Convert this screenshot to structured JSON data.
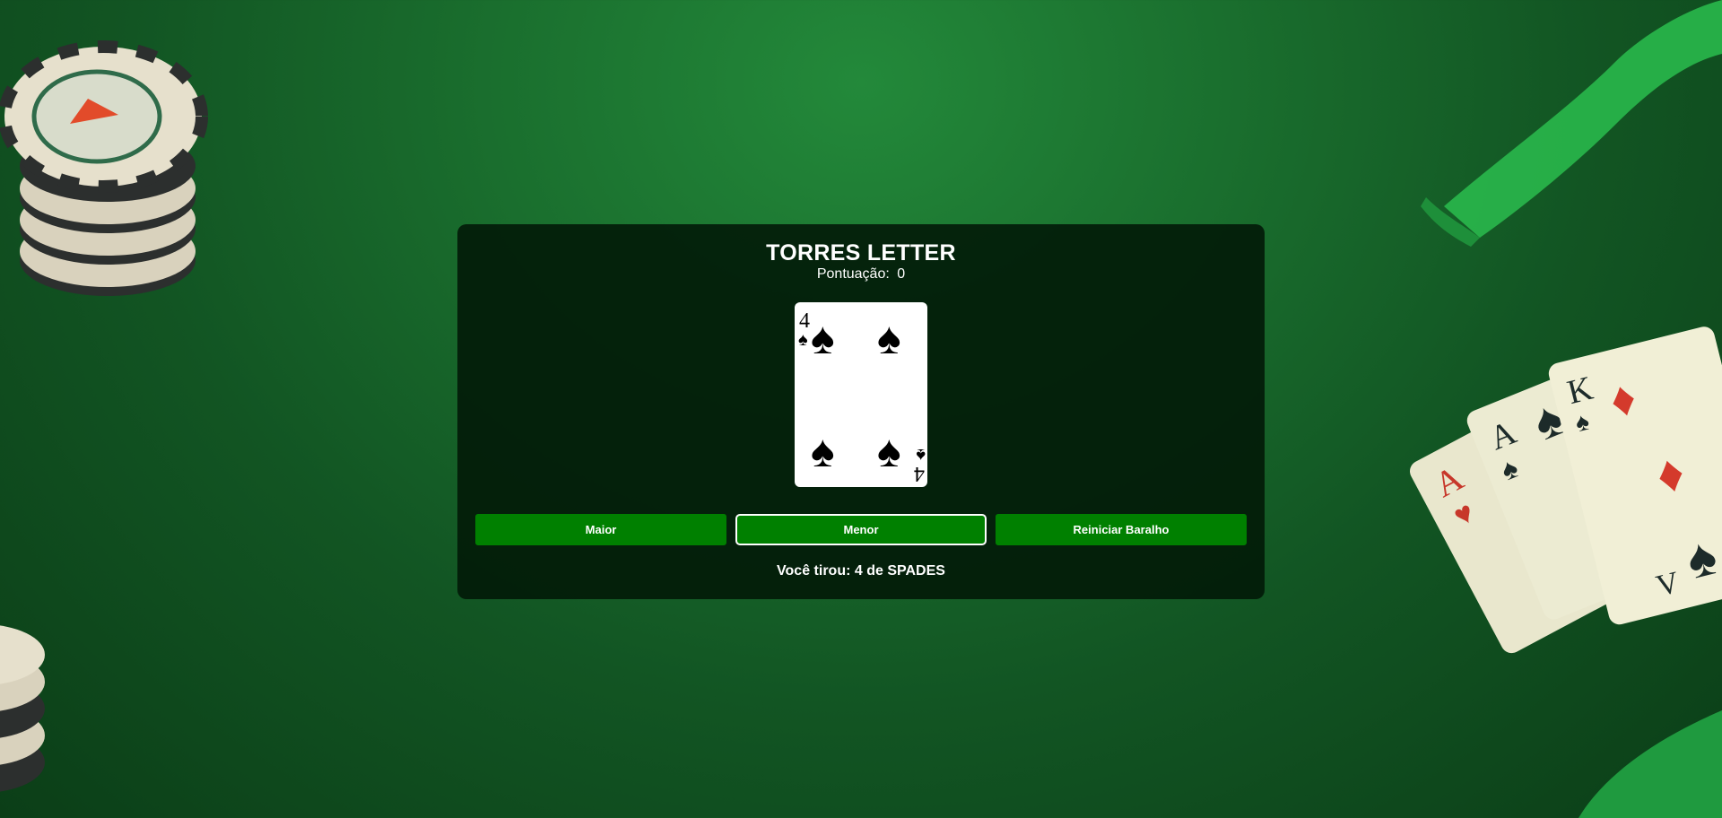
{
  "game": {
    "title": "TORRES LETTER",
    "score_label": "Pontuação:",
    "score_value": "0"
  },
  "card": {
    "rank": "4",
    "suit": "SPADES",
    "suit_symbol": "♠",
    "color": "#000000"
  },
  "buttons": {
    "higher_label": "Maior",
    "lower_label": "Menor",
    "reset_label": "Reiniciar Baralho"
  },
  "result": {
    "text": "Você tirou: 4 de SPADES"
  },
  "colors": {
    "button": "#008000",
    "panel": "#021a08",
    "table": "#1a6f2e"
  }
}
